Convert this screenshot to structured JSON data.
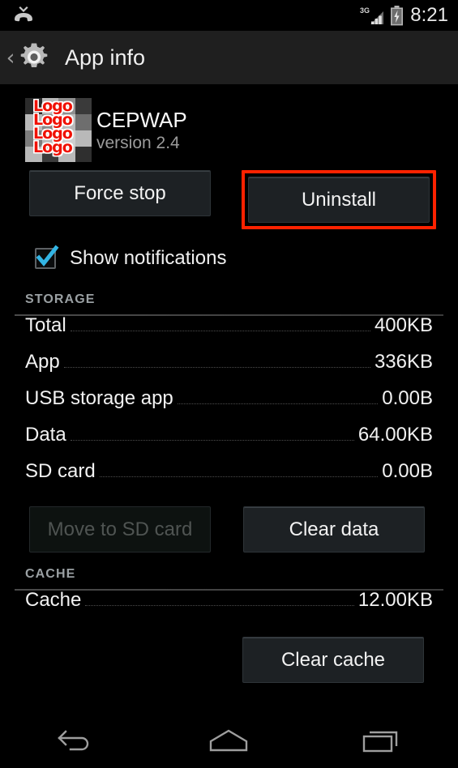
{
  "status_bar": {
    "missed_call_icon": "missed-call-icon",
    "network_label": "3G",
    "signal_icon": "signal-bars-icon",
    "battery_icon": "battery-charging-icon",
    "time": "8:21"
  },
  "action_bar": {
    "back_icon": "back-chevron-icon",
    "app_icon": "settings-gear-icon",
    "title": "App info"
  },
  "app": {
    "icon_logo_text": "Logo",
    "icon_logo_lines": [
      "Logo",
      "Logo",
      "Logo",
      "Logo"
    ],
    "name": "CEPWAP",
    "version": "version 2.4"
  },
  "actions": {
    "force_stop": "Force stop",
    "uninstall": "Uninstall",
    "highlight_color": "#ff2200"
  },
  "notifications": {
    "label": "Show notifications",
    "checked": true,
    "check_color": "#33b5e5"
  },
  "storage": {
    "section_title": "STORAGE",
    "rows": [
      {
        "label": "Total",
        "value": "400KB"
      },
      {
        "label": "App",
        "value": "336KB"
      },
      {
        "label": "USB storage app",
        "value": "0.00B"
      },
      {
        "label": "Data",
        "value": "64.00KB"
      },
      {
        "label": "SD card",
        "value": "0.00B"
      }
    ],
    "move_to_sd": "Move to SD card",
    "move_to_sd_enabled": false,
    "clear_data": "Clear data"
  },
  "cache": {
    "section_title": "CACHE",
    "rows": [
      {
        "label": "Cache",
        "value": "12.00KB"
      }
    ],
    "clear_cache": "Clear cache"
  },
  "nav_bar": {
    "back": "back-nav-icon",
    "home": "home-nav-icon",
    "recents": "recents-nav-icon"
  }
}
